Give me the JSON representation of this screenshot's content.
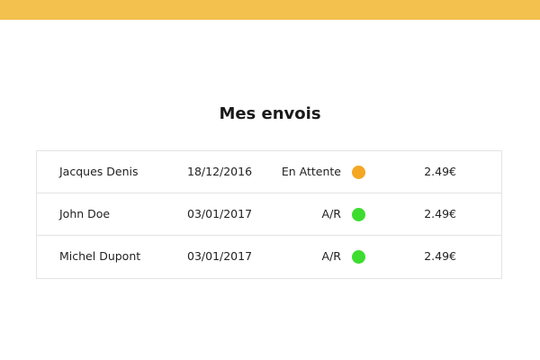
{
  "header": {
    "bar_color": "#f2c14e"
  },
  "page": {
    "title": "Mes envois"
  },
  "status_colors": {
    "pending": "#f5a623",
    "ok": "#3ddc2e"
  },
  "shipments": [
    {
      "name": "Jacques Denis",
      "date": "18/12/2016",
      "status": "En Attente",
      "status_color": "#f5a623",
      "price": "2.49€"
    },
    {
      "name": "John Doe",
      "date": "03/01/2017",
      "status": "A/R",
      "status_color": "#3ddc2e",
      "price": "2.49€"
    },
    {
      "name": "Michel Dupont",
      "date": "03/01/2017",
      "status": "A/R",
      "status_color": "#3ddc2e",
      "price": "2.49€"
    }
  ]
}
